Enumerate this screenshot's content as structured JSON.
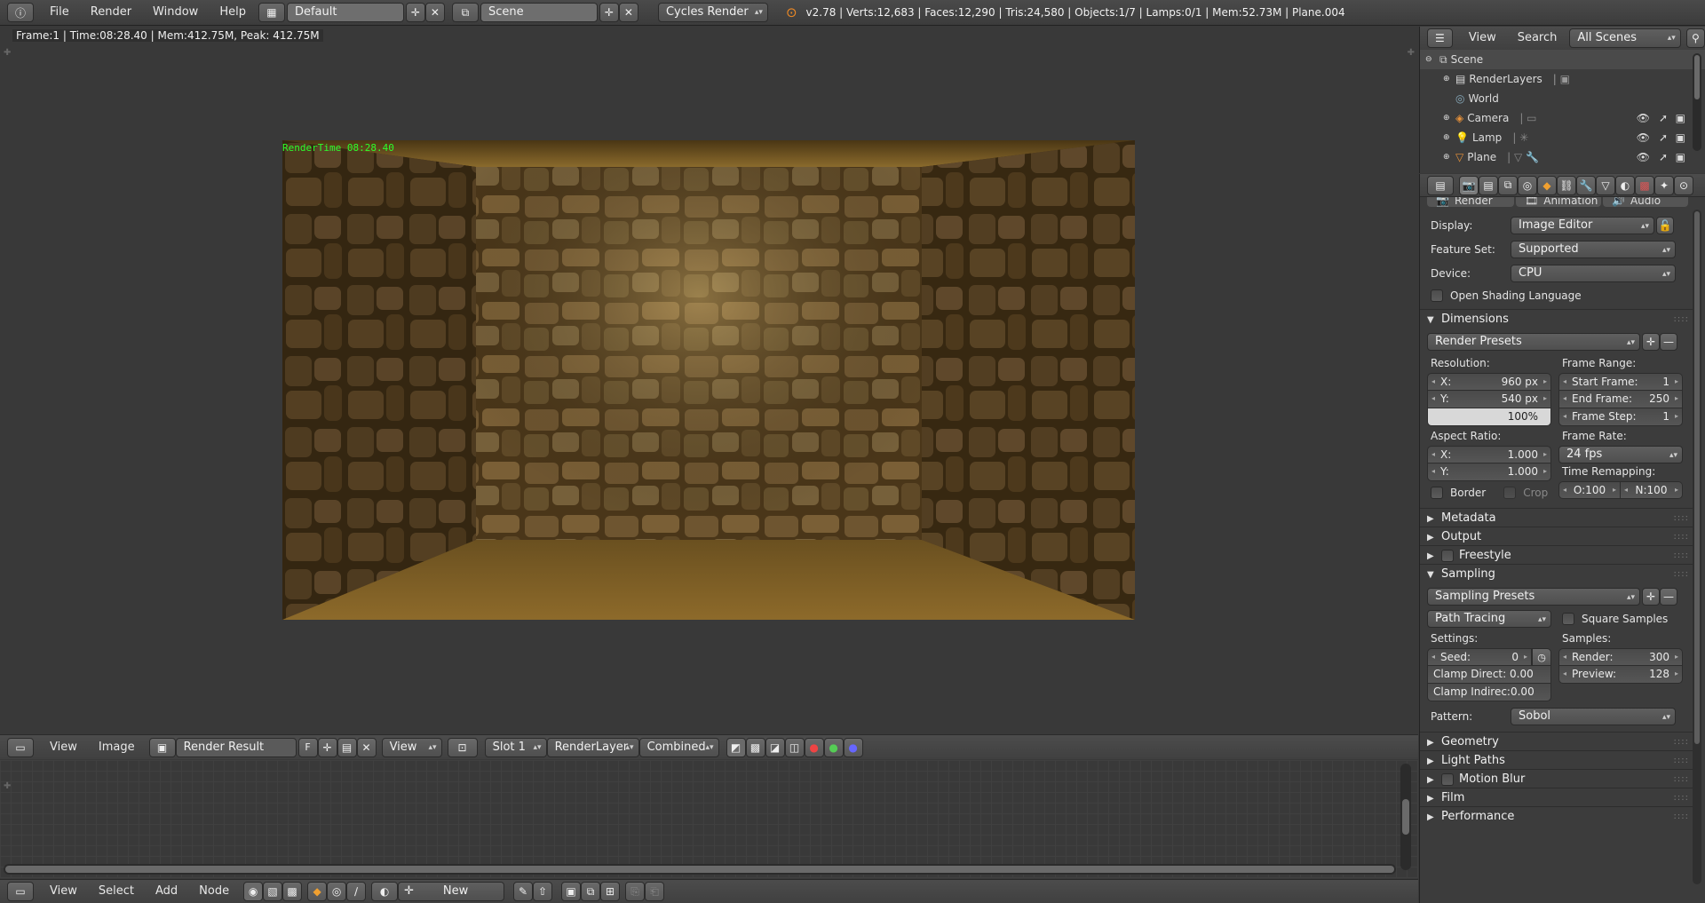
{
  "topbar": {
    "menus": [
      "File",
      "Render",
      "Window",
      "Help"
    ],
    "screen_layout": "Default",
    "scene": "Scene",
    "engine": "Cycles Render",
    "stats": "v2.78 | Verts:12,683 | Faces:12,290 | Tris:24,580 | Objects:1/7 | Lamps:0/1 | Mem:52.73M | Plane.004"
  },
  "image_editor": {
    "info": "Frame:1 | Time:08:28.40 | Mem:412.75M, Peak: 412.75M",
    "render_time": "RenderTime 08:28.40",
    "header_menus": [
      "View",
      "Image"
    ],
    "image_name": "Render Result",
    "fake_user": "F",
    "view_mode": "View",
    "slot": "Slot 1",
    "layer": "RenderLayer",
    "pass": "Combined"
  },
  "node_editor": {
    "menus": [
      "View",
      "Select",
      "Add",
      "Node"
    ],
    "new_label": "New"
  },
  "outliner": {
    "menus": [
      "View",
      "Search"
    ],
    "filter": "All Scenes",
    "items": [
      {
        "label": "Scene"
      },
      {
        "label": "RenderLayers"
      },
      {
        "label": "World"
      },
      {
        "label": "Camera"
      },
      {
        "label": "Lamp"
      },
      {
        "label": "Plane"
      }
    ]
  },
  "properties": {
    "tabs": [
      "Render",
      "Animation",
      "Audio"
    ],
    "display_label": "Display:",
    "display_value": "Image Editor",
    "feature_label": "Feature Set:",
    "feature_value": "Supported",
    "device_label": "Device:",
    "device_value": "CPU",
    "osl_label": "Open Shading Language",
    "dimensions": {
      "title": "Dimensions",
      "presets": "Render Presets",
      "resolution_label": "Resolution:",
      "res_x_label": "X:",
      "res_x": "960 px",
      "res_y_label": "Y:",
      "res_y": "540 px",
      "res_pct": "100%",
      "frame_range_label": "Frame Range:",
      "start_label": "Start Frame:",
      "start": "1",
      "end_label": "End Frame:",
      "end": "250",
      "step_label": "Frame Step:",
      "step": "1",
      "aspect_label": "Aspect Ratio:",
      "asp_x_label": "X:",
      "asp_x": "1.000",
      "asp_y_label": "Y:",
      "asp_y": "1.000",
      "frame_rate_label": "Frame Rate:",
      "frame_rate": "24 fps",
      "time_remap_label": "Time Remapping:",
      "remap_old": "O:100",
      "remap_new": "N:100",
      "border_label": "Border",
      "crop_label": "Crop"
    },
    "collapsed": [
      "Metadata",
      "Output",
      "Freestyle"
    ],
    "sampling": {
      "title": "Sampling",
      "presets": "Sampling Presets",
      "integrator": "Path Tracing",
      "square_label": "Square Samples",
      "settings_label": "Settings:",
      "seed_label": "Seed:",
      "seed": "0",
      "clamp_direct_label": "Clamp Direct:",
      "clamp_direct": "0.00",
      "clamp_indirect_label": "Clamp Indirec:",
      "clamp_indirect": "0.00",
      "samples_label": "Samples:",
      "render_label": "Render:",
      "render": "300",
      "preview_label": "Preview:",
      "preview": "128",
      "pattern_label": "Pattern:",
      "pattern": "Sobol"
    },
    "bottom_panels": [
      "Geometry",
      "Light Paths",
      "Motion Blur",
      "Film",
      "Performance"
    ]
  }
}
